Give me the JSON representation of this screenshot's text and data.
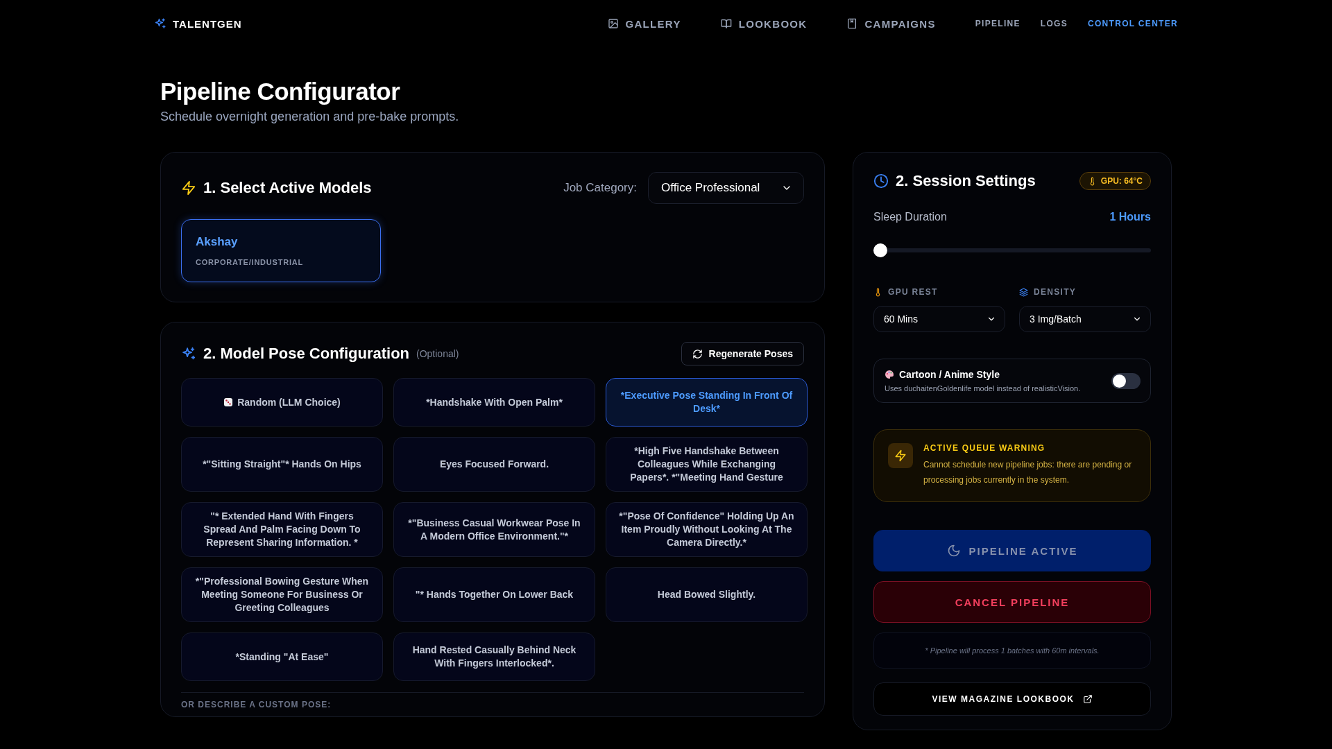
{
  "brand": {
    "name": "TALENTGEN"
  },
  "nav": [
    {
      "label": "GALLERY",
      "kind": "with-icon",
      "selected": false
    },
    {
      "label": "LOOKBOOK",
      "kind": "with-icon",
      "selected": false
    },
    {
      "label": "CAMPAIGNS",
      "kind": "with-icon",
      "selected": false
    },
    {
      "label": "PIPELINE",
      "kind": "plain",
      "selected": false
    },
    {
      "label": "LOGS",
      "kind": "plain",
      "selected": false
    },
    {
      "label": "CONTROL CENTER",
      "kind": "plain",
      "selected": true
    }
  ],
  "page": {
    "title": "Pipeline Configurator",
    "subtitle": "Schedule overnight generation and pre-bake prompts."
  },
  "models_card": {
    "title": "1. Select Active Models",
    "category_label": "Job Category:",
    "category_value": "Office Professional",
    "models": [
      {
        "name": "Akshay",
        "group": "CORPORATE/INDUSTRIAL",
        "selected": true
      }
    ]
  },
  "pose_card": {
    "title": "2. Model Pose Configuration",
    "note": "(Optional)",
    "regenerate_button": "Regenerate Poses",
    "poses": [
      {
        "label": "Random (LLM Choice)",
        "kind": "random",
        "selected": false
      },
      {
        "label": "*Handshake With Open Palm*",
        "kind": "pose",
        "selected": false
      },
      {
        "label": "*Executive Pose Standing In Front Of Desk*",
        "kind": "pose",
        "selected": true
      },
      {
        "label": "*\"Sitting Straight\"* Hands On Hips",
        "kind": "pose",
        "selected": false
      },
      {
        "label": "Eyes Focused Forward.",
        "kind": "pose",
        "selected": false
      },
      {
        "label": "*High Five Handshake Between Colleagues While Exchanging Papers*. *\"Meeting Hand Gesture",
        "kind": "pose",
        "selected": false
      },
      {
        "label": "\"* Extended Hand With Fingers Spread And Palm Facing Down To Represent Sharing Information. *",
        "kind": "pose",
        "selected": false
      },
      {
        "label": "*\"Business Casual Workwear Pose In A Modern Office Environment.\"*",
        "kind": "pose",
        "selected": false
      },
      {
        "label": "*\"Pose Of Confidence\" Holding Up An Item Proudly Without Looking At The Camera Directly.*",
        "kind": "pose",
        "selected": false
      },
      {
        "label": "*\"Professional Bowing Gesture When Meeting Someone For Business Or Greeting Colleagues",
        "kind": "pose",
        "selected": false
      },
      {
        "label": "\"* Hands Together On Lower Back",
        "kind": "pose",
        "selected": false
      },
      {
        "label": "Head Bowed Slightly.",
        "kind": "pose",
        "selected": false
      },
      {
        "label": "*Standing \"At Ease\"",
        "kind": "pose",
        "selected": false
      },
      {
        "label": "Hand Rested Casually Behind Neck With Fingers Interlocked*.",
        "kind": "pose",
        "selected": false
      }
    ],
    "custom_label": "OR DESCRIBE A CUSTOM POSE:"
  },
  "session": {
    "title": "2. Session Settings",
    "gpu_badge": "GPU: 64°C",
    "sleep_label": "Sleep Duration",
    "sleep_value": "1 Hours",
    "sleep_slider": {
      "level": 0
    },
    "gpu_rest": {
      "label": "GPU REST",
      "value": "60 Mins"
    },
    "density": {
      "label": "DENSITY",
      "value": "3 Img/Batch"
    },
    "style_toggle": {
      "title": "Cartoon / Anime Style",
      "description": "Uses duchaitenGoldenlife model instead of realisticVision.",
      "on": false
    },
    "warning": {
      "title": "ACTIVE QUEUE WARNING",
      "text": "Cannot schedule new pipeline jobs: there are pending or processing jobs currently in the system."
    },
    "active_button": {
      "label": "PIPELINE ACTIVE",
      "disabled": true
    },
    "cancel_button": "CANCEL PIPELINE",
    "footnote": "* Pipeline will process 1 batches with 60m intervals.",
    "lookbook_button": "VIEW MAGAZINE LOOKBOOK"
  }
}
